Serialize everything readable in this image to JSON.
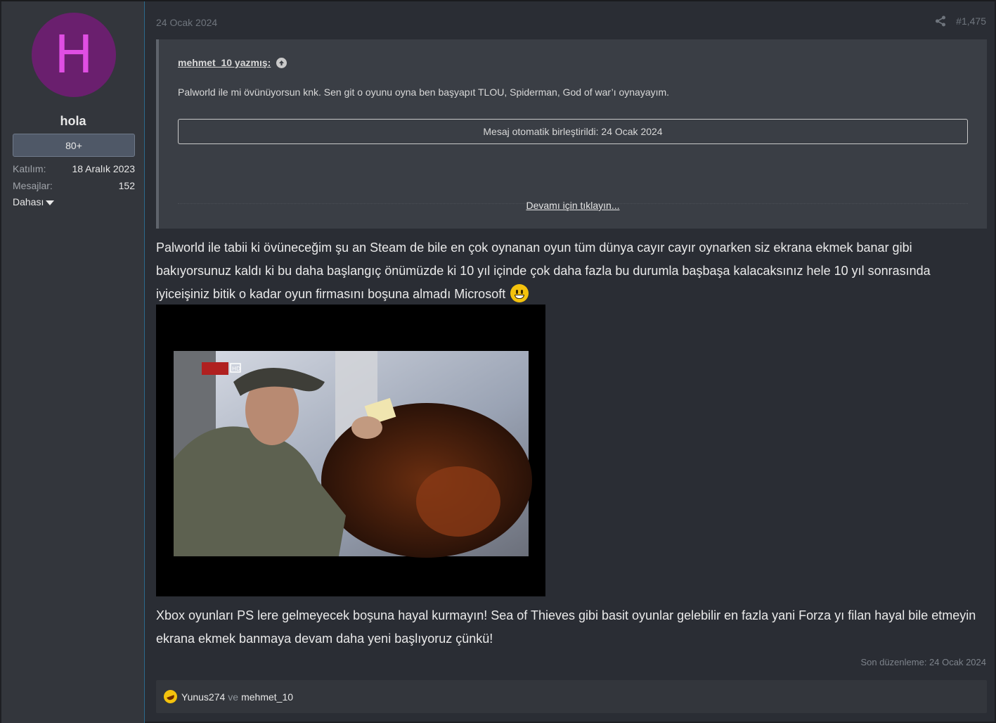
{
  "user": {
    "avatar_letter": "H",
    "avatar_color": "#6a1f6e",
    "name": "hola",
    "rank": "80+",
    "stats": [
      {
        "label": "Katılım:",
        "value": "18 Aralık 2023"
      },
      {
        "label": "Mesajlar:",
        "value": "152"
      }
    ],
    "more_label": "Dahası"
  },
  "post": {
    "date": "24 Ocak 2024",
    "number": "#1,475",
    "quote": {
      "author": "mehmet_10 yazmış:",
      "text": "Palworld ile mi övünüyorsun knk. Sen git o oyunu oyna ben başyapıt TLOU, Spiderman, God of war’ı oynayayım.",
      "merged_notice": "Mesaj otomatik birleştirildi: 24 Ocak 2024",
      "expand_label": "Devamı için tıklayın..."
    },
    "body_1": "Palworld ile tabii ki övüneceğim şu an Steam de bile en çok oynanan oyun tüm dünya cayır cayır oynarken siz ekrana ekmek banar gibi bakıyorsunuz kaldı ki bu daha başlangıç önümüzde ki 10 yıl içinde çok daha fazla bu durumla başbaşa kalacaksınız hele 10 yıl sonrasında iyiceişiniz bitik o kadar oyun firmasını boşuna almadı Microsoft",
    "body_1_emoji": "grinning-face-icon",
    "image_caption_logo": "HD",
    "body_2": "Xbox oyunları PS lere gelmeyecek boşuna hayal kurmayın! Sea of Thieves gibi basit oyunlar gelebilir en fazla yani Forza yı filan hayal bile etmeyin ekrana ekmek banmaya devam daha yeni başlıyoruz çünkü!",
    "edited": "Son düzenleme: 24 Ocak 2024",
    "reactions": {
      "emoji": "rolling-laughing-icon",
      "user_1": "Yunus274",
      "and": "ve",
      "user_2": "mehmet_10"
    }
  }
}
